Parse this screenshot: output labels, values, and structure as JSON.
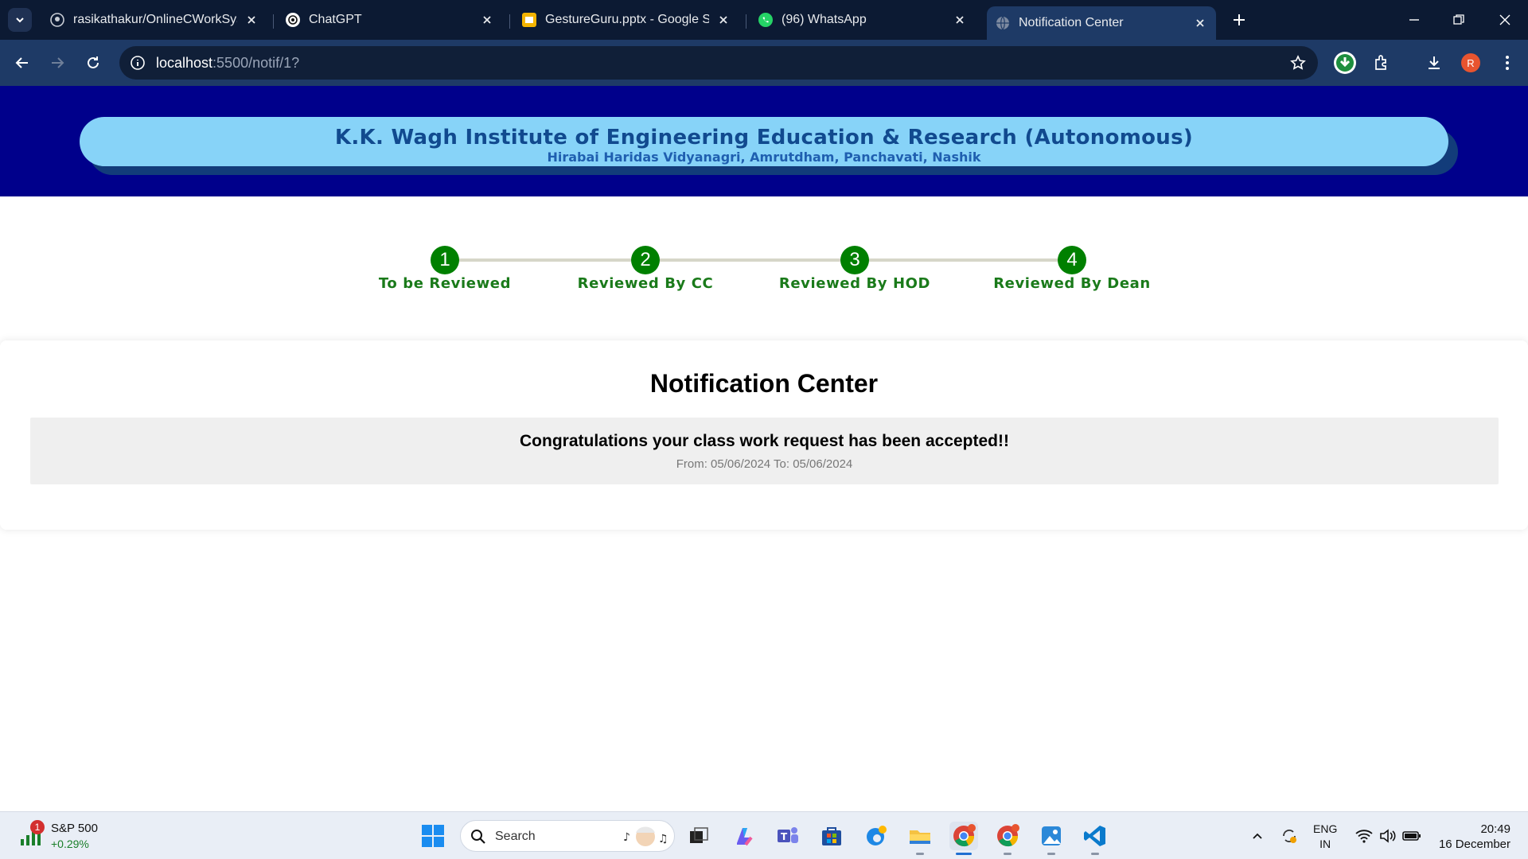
{
  "browser": {
    "tabs": [
      {
        "title": "rasikathakur/OnlineCWorkSyste",
        "icon": "github-icon"
      },
      {
        "title": "ChatGPT",
        "icon": "chatgpt-icon"
      },
      {
        "title": "GestureGuru.pptx - Google Slid",
        "icon": "google-slides-icon"
      },
      {
        "title": "(96) WhatsApp",
        "icon": "whatsapp-icon"
      },
      {
        "title": "Notification Center",
        "icon": "globe-icon",
        "active": true
      }
    ],
    "url_host": "localhost",
    "url_path": ":5500/notif/1?",
    "profile_initial": "R"
  },
  "header": {
    "institute": "K.K. Wagh Institute of Engineering Education & Research (Autonomous)",
    "address": "Hirabai Haridas Vidyanagri, Amrutdham, Panchavati, Nashik"
  },
  "steps": [
    {
      "number": "1",
      "label": "To be Reviewed"
    },
    {
      "number": "2",
      "label": "Reviewed By CC"
    },
    {
      "number": "3",
      "label": "Reviewed By HOD"
    },
    {
      "number": "4",
      "label": "Reviewed By Dean"
    }
  ],
  "notifications": {
    "title": "Notification Center",
    "items": [
      {
        "message": "Congratulations your class work request has been accepted!!",
        "dates": "From: 05/06/2024 To: 05/06/2024"
      }
    ]
  },
  "taskbar": {
    "stock_name": "S&P 500",
    "stock_change": "+0.29%",
    "stock_badge": "1",
    "search_label": "Search",
    "lang_line1": "ENG",
    "lang_line2": "IN",
    "time": "20:49",
    "date": "16 December"
  },
  "colors": {
    "header_bg": "#00008b",
    "banner_bg": "#87d3f8",
    "step_green": "#008000",
    "chrome_dark": "#0c1a33",
    "chrome_toolbar": "#1e3a66"
  }
}
